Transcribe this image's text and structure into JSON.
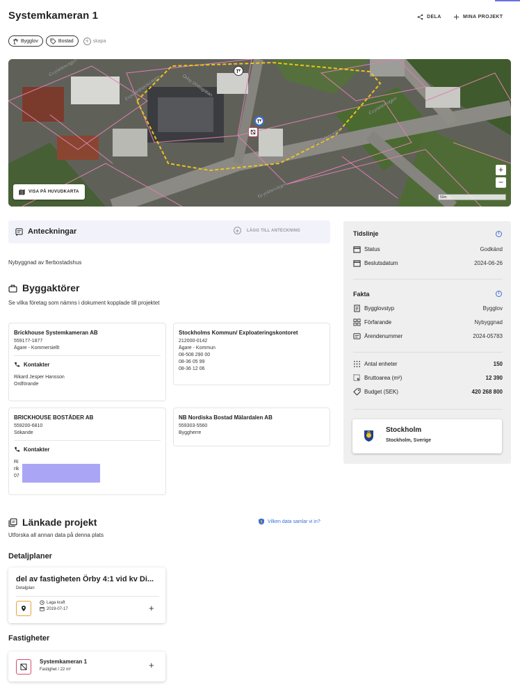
{
  "header": {
    "title": "Systemkameran 1",
    "share_label": "DELA",
    "my_projects_label": "MINA PROJEKT"
  },
  "tags": [
    {
      "label": "Bygglov",
      "icon": "crane-icon"
    },
    {
      "label": "Bostad",
      "icon": "tag-icon"
    }
  ],
  "create_label": "skapa",
  "map": {
    "main_map_button": "VISA PÅ HUVUDKARTA",
    "zoom_in": "+",
    "zoom_out": "−",
    "scale_label": "50m",
    "street_labels": [
      "Gryckbovägen",
      "Gryckbovägen",
      "Gryckbovägen",
      "Gryckbovägen",
      "Fredrikshovsvägen",
      "Örby slottsgatan"
    ]
  },
  "notes": {
    "title": "Anteckningar",
    "add_label": "LÄGG TILL ANTECKNING",
    "text": "Nybyggnad av flerbostadshus"
  },
  "builders": {
    "title": "Byggaktörer",
    "subtitle": "Se vilka företag som nämns i dokument kopplade till projektet",
    "contacts_label": "Kontakter",
    "cards": [
      {
        "name": "Brickhouse Systemkameran AB",
        "lines": [
          "559177-1877",
          "Ägare - Kommersiellt"
        ],
        "contacts": [
          "Rikard Jesper Hansson",
          "Ordförande"
        ]
      },
      {
        "name": "Stockholms Kommun/ Exploateringskontoret",
        "lines": [
          "212000-0142",
          "Ägare - Kommun",
          "08-508 290 00",
          "08-36 05 99",
          "08-36 12 06"
        ]
      },
      {
        "name": "BRICKHOUSE BOSTÄDER AB",
        "lines": [
          "559200-6810",
          "Sökande"
        ],
        "contacts": [
          "Ri",
          "rik",
          "07"
        ]
      },
      {
        "name": "NB Nordiska Bostad Mälardalen AB",
        "lines": [
          "559303-5560",
          "Byggherre"
        ]
      }
    ]
  },
  "timeline": {
    "title": "Tidslinje",
    "rows": [
      {
        "label": "Status",
        "value": "Godkänd"
      },
      {
        "label": "Beslutsdatum",
        "value": "2024-06-26"
      }
    ]
  },
  "facts": {
    "title": "Fakta",
    "rows": [
      {
        "label": "Bygglovstyp",
        "value": "Bygglov"
      },
      {
        "label": "Förfarande",
        "value": "Nybyggnad"
      },
      {
        "label": "Ärendenummer",
        "value": "2024-05783"
      }
    ],
    "metrics": [
      {
        "label": "Antal enheter",
        "value": "150"
      },
      {
        "label": "Bruttoarea (m²)",
        "value": "12 390"
      },
      {
        "label": "Budget (SEK)",
        "value": "420 268 800"
      }
    ]
  },
  "municipality": {
    "name": "Stockholm",
    "location": "Stockholm, Sverige"
  },
  "linked": {
    "title": "Länkade projekt",
    "subtitle": "Utforska all annan data på denna plats",
    "data_link": "Vilken data samlar vi in?",
    "detailplaner_title": "Detaljplaner",
    "plan": {
      "title": "del av fastigheten Örby 4:1 vid kv Di...",
      "type": "Detaljplan",
      "status": "Laga kraft",
      "date": "2019-07-17"
    },
    "fastigheter_title": "Fastigheter",
    "property": {
      "title": "Systemkameran 1",
      "sub": "Fastighet / 22 m²"
    }
  },
  "colors": {
    "accent": "#3b6fd6",
    "property_border": "#d84b6a",
    "plan_border": "#e7a23a",
    "redaction": "#aaa6f5"
  }
}
